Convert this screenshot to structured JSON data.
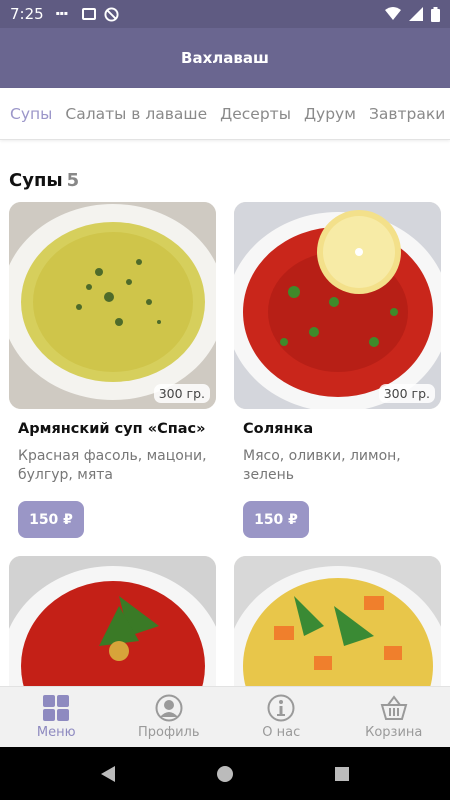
{
  "status": {
    "time": "7:25"
  },
  "app": {
    "title": "Вахлаваш"
  },
  "tabs": [
    {
      "label": "Супы"
    },
    {
      "label": "Салаты в лаваше"
    },
    {
      "label": "Десерты"
    },
    {
      "label": "Дурум"
    },
    {
      "label": "Завтраки"
    }
  ],
  "section": {
    "title": "Супы",
    "count": "5"
  },
  "products": [
    {
      "name": "Армянский суп «Спас»",
      "description": "Красная фасоль, мацони, булгур, мята",
      "weight": "300 гр.",
      "price": "150 ₽"
    },
    {
      "name": "Солянка",
      "description": "Мясо, оливки, лимон, зелень",
      "weight": "300 гр.",
      "price": "150 ₽"
    },
    {
      "name": "",
      "description": "",
      "weight": "",
      "price": ""
    },
    {
      "name": "",
      "description": "",
      "weight": "",
      "price": ""
    }
  ],
  "bottom_nav": [
    {
      "label": "Меню",
      "icon": "grid-icon"
    },
    {
      "label": "Профиль",
      "icon": "user-icon"
    },
    {
      "label": "О нас",
      "icon": "info-icon"
    },
    {
      "label": "Корзина",
      "icon": "basket-icon"
    }
  ],
  "colors": {
    "accent": "#9b96c9",
    "appbar": "#6a6690",
    "statusbar": "#5f5b82"
  }
}
